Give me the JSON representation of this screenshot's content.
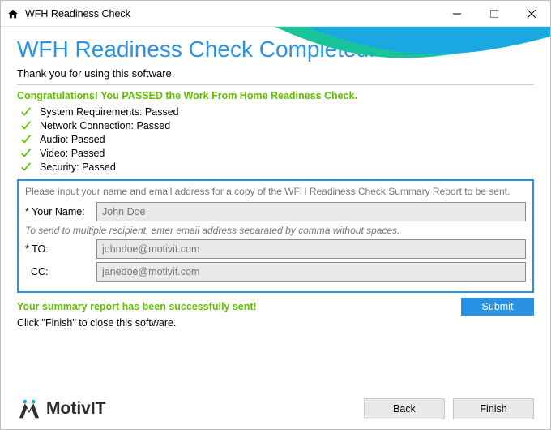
{
  "window": {
    "title": "WFH Readiness Check"
  },
  "main": {
    "heading": "WFH Readiness Check Completed!",
    "thanks": "Thank you for using this software.",
    "congrats": "Congratulations! You PASSED the Work From Home Readiness Check.",
    "checks": [
      {
        "label": "System Requirements:  Passed"
      },
      {
        "label": "Network Connection:  Passed"
      },
      {
        "label": "Audio:  Passed"
      },
      {
        "label": "Video:  Passed"
      },
      {
        "label": "Security:  Passed"
      }
    ]
  },
  "form": {
    "instruction": "Please input your name and email address for a copy of the WFH Readiness Check Summary Report to be sent.",
    "name_label": "* Your Name:",
    "name_value": "John Doe",
    "multi_hint": "To send to multiple recipient, enter email address separated by comma without spaces.",
    "to_label": "* TO:",
    "to_value": "johndoe@motivit.com",
    "cc_label": "  CC:",
    "cc_value": "janedoe@motivit.com"
  },
  "status": {
    "sent": "Your summary report has been successfully sent!",
    "submit_label": "Submit",
    "finish_msg": "Click \"Finish\" to close this software."
  },
  "footer": {
    "brand": "MotivIT",
    "back": "Back",
    "finish": "Finish"
  }
}
